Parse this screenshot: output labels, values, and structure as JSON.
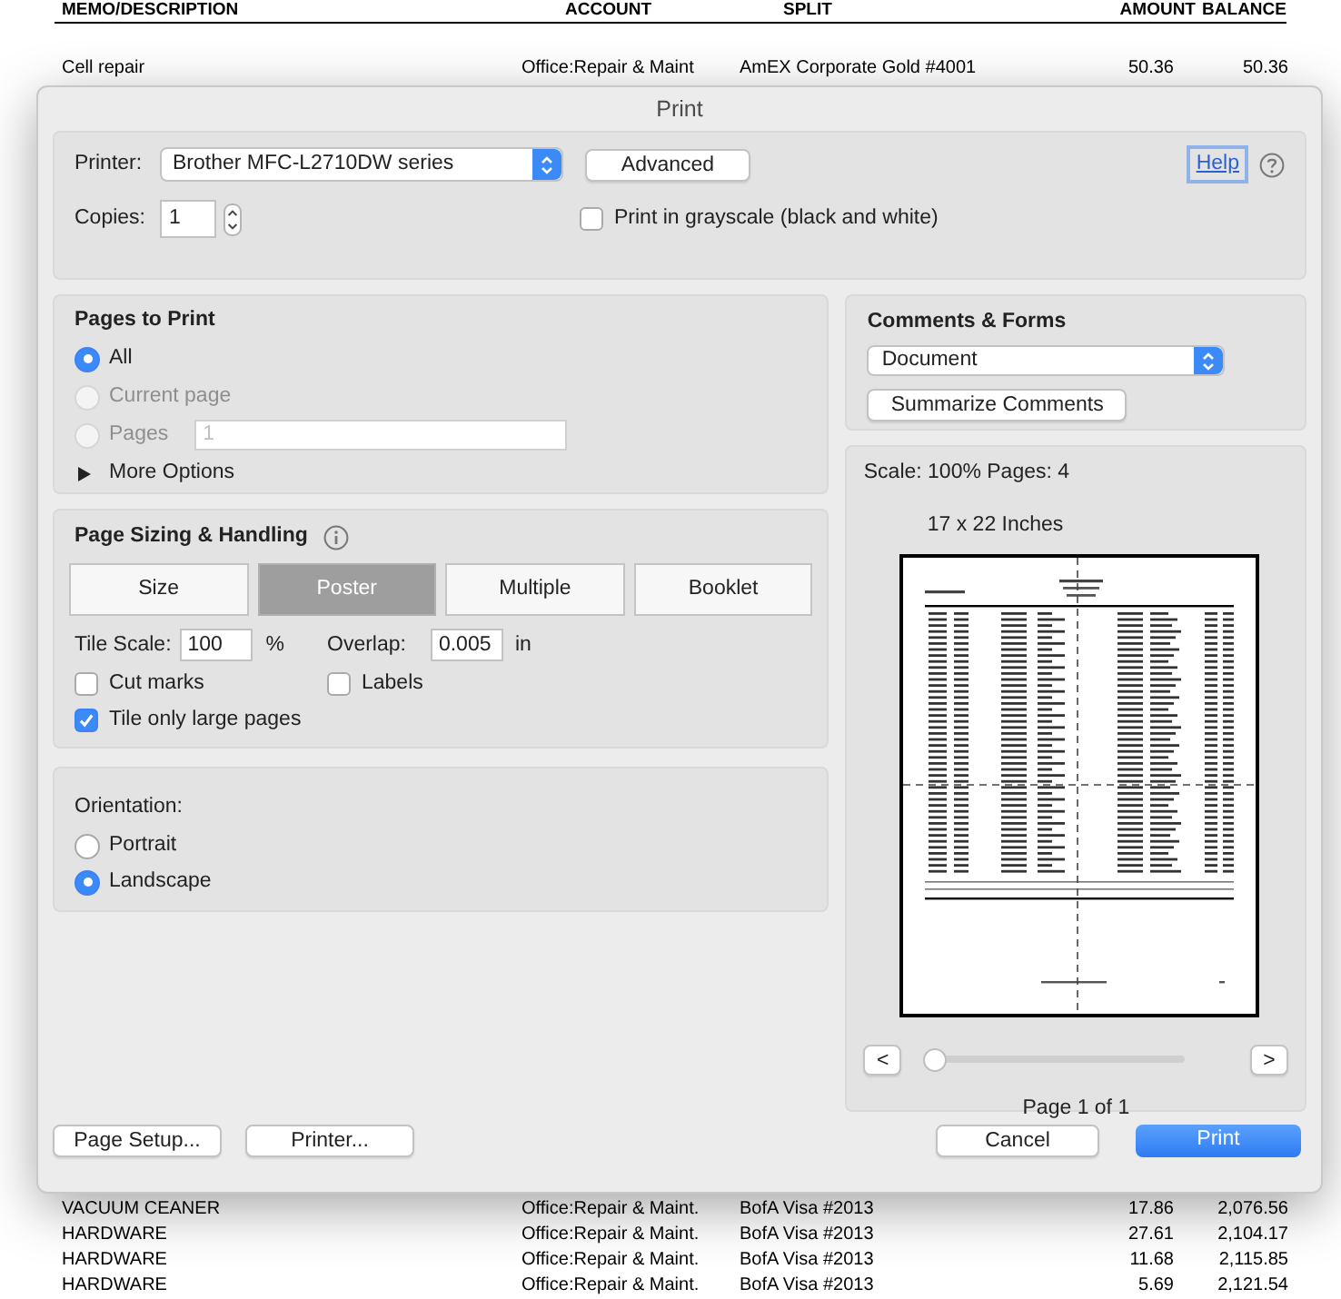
{
  "report": {
    "columns": [
      "MEMO/DESCRIPTION",
      "ACCOUNT",
      "SPLIT",
      "AMOUNT",
      "BALANCE"
    ],
    "top_rows": [
      {
        "memo": "Cell repair",
        "account": "Office:Repair & Maint",
        "split": "AmEX Corporate Gold #4001",
        "amount": "50.36",
        "balance": "50.36"
      }
    ],
    "bottom_rows": [
      {
        "memo": "VACUUM CEANER",
        "account": "Office:Repair & Maint.",
        "split": "BofA  Visa #2013",
        "amount": "17.86",
        "balance": "2,076.56"
      },
      {
        "memo": "HARDWARE",
        "account": "Office:Repair & Maint.",
        "split": "BofA  Visa #2013",
        "amount": "27.61",
        "balance": "2,104.17"
      },
      {
        "memo": "HARDWARE",
        "account": "Office:Repair & Maint.",
        "split": "BofA  Visa #2013",
        "amount": "11.68",
        "balance": "2,115.85"
      },
      {
        "memo": "HARDWARE",
        "account": "Office:Repair & Maint.",
        "split": "BofA  Visa #2013",
        "amount": "5.69",
        "balance": "2,121.54"
      }
    ]
  },
  "dialog": {
    "title": "Print",
    "printer": {
      "label": "Printer:",
      "value": "Brother MFC-L2710DW series"
    },
    "advanced_button": "Advanced",
    "help_link": "Help",
    "copies": {
      "label": "Copies:",
      "value": "1"
    },
    "grayscale": {
      "label": "Print in grayscale (black and white)",
      "checked": false
    },
    "pages_to_print": {
      "title": "Pages to Print",
      "options": [
        {
          "label": "All",
          "selected": true,
          "disabled": false
        },
        {
          "label": "Current page",
          "selected": false,
          "disabled": true
        },
        {
          "label": "Pages",
          "selected": false,
          "disabled": true,
          "field_value": "1"
        }
      ],
      "more_options": "More Options"
    },
    "page_sizing": {
      "title": "Page Sizing & Handling",
      "modes": [
        {
          "label": "Size",
          "selected": false
        },
        {
          "label": "Poster",
          "selected": true
        },
        {
          "label": "Multiple",
          "selected": false
        },
        {
          "label": "Booklet",
          "selected": false
        }
      ],
      "tile_scale": {
        "label": "Tile Scale:",
        "value": "100",
        "unit": "%"
      },
      "overlap": {
        "label": "Overlap:",
        "value": "0.005",
        "unit": "in"
      },
      "checkboxes": [
        {
          "label": "Cut marks",
          "checked": false
        },
        {
          "label": "Labels",
          "checked": false
        },
        {
          "label": "Tile only large pages",
          "checked": true
        }
      ]
    },
    "orientation": {
      "title": "Orientation:",
      "options": [
        {
          "label": "Portrait",
          "selected": false
        },
        {
          "label": "Landscape",
          "selected": true
        }
      ]
    },
    "comments_forms": {
      "title": "Comments & Forms",
      "value": "Document",
      "button": "Summarize Comments"
    },
    "preview": {
      "scale_info": "Scale: 100% Pages: 4",
      "paper_size": "17 x 22 Inches",
      "prev": "<",
      "next": ">",
      "level": 0,
      "page_indicator": "Page 1 of 1"
    },
    "footer": {
      "left_buttons": [
        "Page Setup...",
        "Printer..."
      ],
      "cancel": "Cancel",
      "print": "Print"
    }
  }
}
